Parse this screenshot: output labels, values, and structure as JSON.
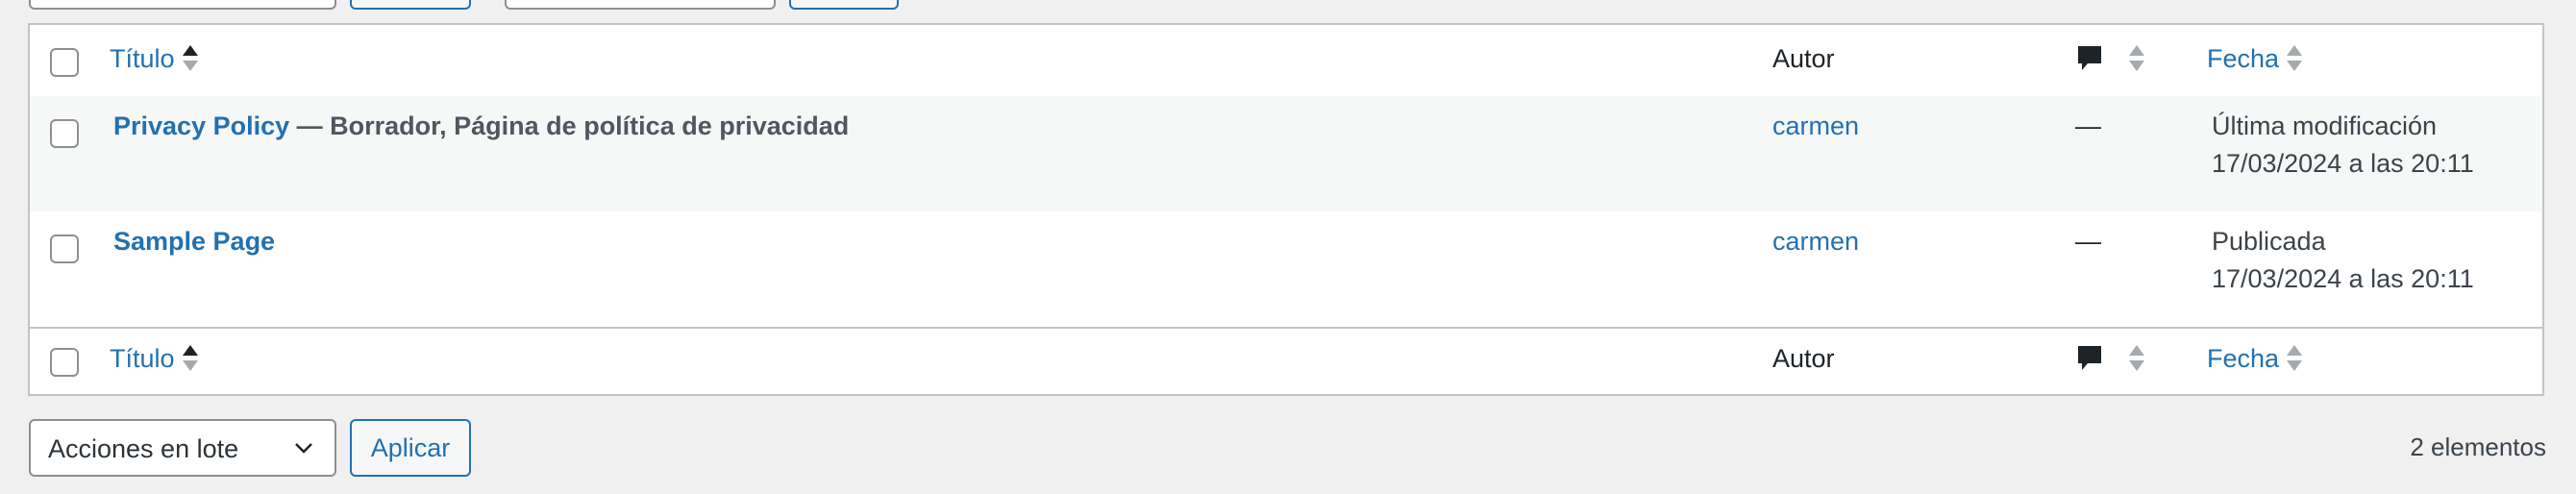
{
  "table": {
    "columns": {
      "title": "Título",
      "author": "Autor",
      "date": "Fecha"
    },
    "rows": [
      {
        "title": "Privacy Policy",
        "state": " — Borrador, Página de política de privacidad",
        "author": "carmen",
        "comments": "—",
        "date_status": "Última modificación",
        "date_value": "17/03/2024 a las 20:11"
      },
      {
        "title": "Sample Page",
        "state": "",
        "author": "carmen",
        "comments": "—",
        "date_status": "Publicada",
        "date_value": "17/03/2024 a las 20:11"
      }
    ]
  },
  "bulk": {
    "select_label": "Acciones en lote",
    "apply_label": "Aplicar"
  },
  "count": "2 elementos",
  "icons": {
    "comment": "comment-bubble-icon",
    "sort": "sort-arrows-icon",
    "chevron": "chevron-down-icon"
  },
  "colors": {
    "link": "#2271b1",
    "border": "#c3c4c7",
    "background": "#f0f0f1",
    "alt_row": "#f6f7f7"
  }
}
